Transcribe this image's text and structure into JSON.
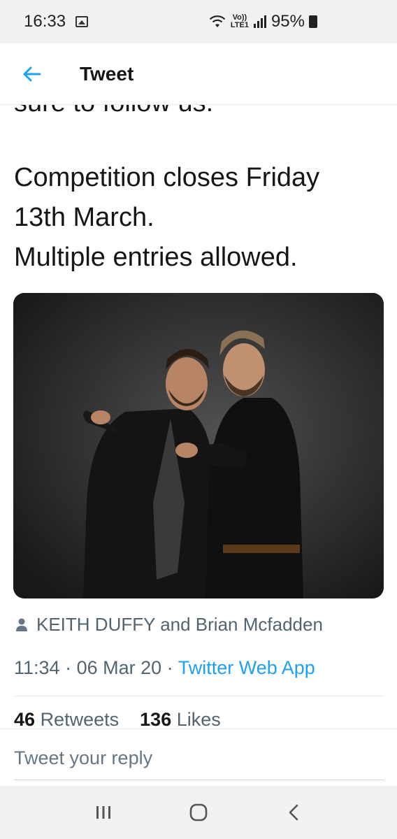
{
  "status_bar": {
    "time": "16:33",
    "network_top": "Vo))",
    "network_bottom": "LTE1",
    "battery": "95%"
  },
  "header": {
    "title": "Tweet"
  },
  "tweet": {
    "cut_off_line": "sure to follow us.",
    "lines": [
      "Competition closes Friday",
      "13th March.",
      "Multiple entries allowed."
    ],
    "tagged_people": "KEITH DUFFY and Brian Mcfadden",
    "time": "11:34",
    "date": "06 Mar 20",
    "separator": "·",
    "source": "Twitter Web App",
    "retweets_count": "46",
    "retweets_label": "Retweets",
    "likes_count": "136",
    "likes_label": "Likes"
  },
  "reply": {
    "placeholder": "Tweet your reply"
  },
  "colors": {
    "accent": "#1da1f2",
    "text": "#14171a",
    "secondary": "#536471"
  }
}
